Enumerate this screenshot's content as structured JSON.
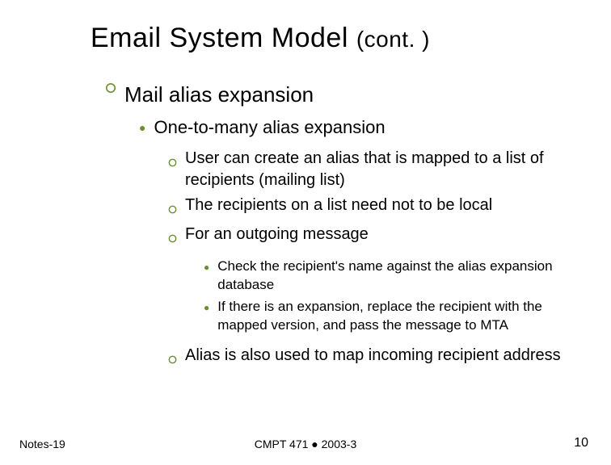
{
  "title_main": "Email System Model ",
  "title_cont": "(cont. )",
  "lvl1": "Mail alias expansion",
  "lvl2": "One-to-many alias expansion",
  "lvl3": [
    "User can create an alias that is mapped to a list of recipients (mailing list)",
    "The recipients on a list need not to be local",
    "For an outgoing message"
  ],
  "lvl4": [
    "Check the recipient's name against the alias expansion database",
    "If there is an expansion, replace the recipient with the mapped version, and pass the message to MTA"
  ],
  "lvl3_after": "Alias is also used to map incoming recipient address",
  "footer": {
    "left": "Notes-19",
    "center": "CMPT 471 ● 2003-3",
    "right": "10"
  }
}
